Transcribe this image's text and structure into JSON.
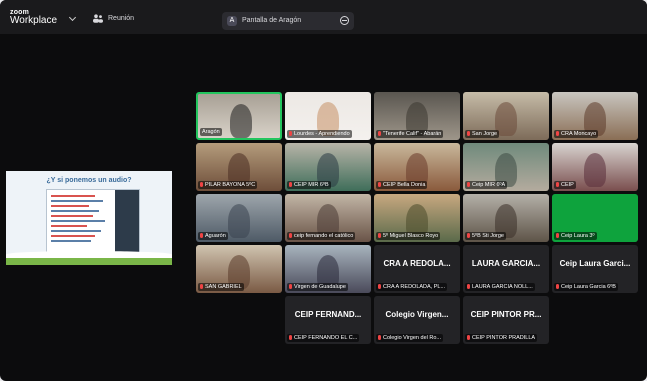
{
  "app": {
    "logo_top": "zoom",
    "logo_bottom": "Workplace",
    "meeting_label": "Reunión"
  },
  "share": {
    "avatar_letter": "A",
    "label": "Pantalla de Aragón"
  },
  "shared_screen": {
    "title": "¿Y si ponemos un audio?"
  },
  "tiles": [
    {
      "name": "Aragón",
      "type": "video",
      "speaking": true,
      "mic_muted": false,
      "bg": [
        "#a8a095",
        "#d8d2c8"
      ],
      "person": "#1d1d1d"
    },
    {
      "name": "Lourdes - Aprendiendo",
      "type": "video",
      "speaking": false,
      "mic_muted": true,
      "bg": [
        "#ece8e4",
        "#f4f1ee"
      ],
      "person": "#c79064"
    },
    {
      "name": "\"Tenerife Calif\" - Abarán",
      "type": "video",
      "speaking": false,
      "mic_muted": true,
      "bg": [
        "#5a5650",
        "#9e968a"
      ],
      "person": "#3a3630"
    },
    {
      "name": "San Jorge",
      "type": "video",
      "speaking": false,
      "mic_muted": true,
      "bg": [
        "#c6bca8",
        "#7d6b59"
      ],
      "person": "#6b4a3a"
    },
    {
      "name": "CRA Moncayo",
      "type": "video",
      "speaking": false,
      "mic_muted": true,
      "bg": [
        "#c9c6c0",
        "#8a6e55"
      ],
      "person": "#5c3b2a"
    },
    {
      "name": "PILAR BAYONA 5ºC",
      "type": "video",
      "speaking": false,
      "mic_muted": true,
      "bg": [
        "#b49c7c",
        "#6e4e3a"
      ],
      "person": "#4a2e22"
    },
    {
      "name": "CEIP MIR 6ºB",
      "type": "video",
      "speaking": false,
      "mic_muted": true,
      "bg": [
        "#b8b4a8",
        "#3f6e5a"
      ],
      "person": "#2a3a44"
    },
    {
      "name": "CEIP Bella Donia",
      "type": "video",
      "speaking": false,
      "mic_muted": true,
      "bg": [
        "#c9b89c",
        "#8a5a3c"
      ],
      "person": "#6a3a2a"
    },
    {
      "name": "Ceip MIR 6ºA",
      "type": "video",
      "speaking": false,
      "mic_muted": true,
      "bg": [
        "#6f8a7c",
        "#b4ab9e"
      ],
      "person": "#3c4a44"
    },
    {
      "name": "CEIP",
      "type": "video",
      "speaking": false,
      "mic_muted": true,
      "bg": [
        "#d8d4d0",
        "#7a4e4e"
      ],
      "person": "#5a2e3a"
    },
    {
      "name": "Aguarón",
      "type": "video",
      "speaking": false,
      "mic_muted": true,
      "bg": [
        "#9ea6ac",
        "#4e5a66"
      ],
      "person": "#3a4450"
    },
    {
      "name": "ceip fernando el católico",
      "type": "video",
      "speaking": false,
      "mic_muted": true,
      "bg": [
        "#c2b6a6",
        "#6a5448"
      ],
      "person": "#4a3a34"
    },
    {
      "name": "5º Miguel Blasco Royo",
      "type": "video",
      "speaking": false,
      "mic_muted": true,
      "bg": [
        "#c8a880",
        "#5a6a4a"
      ],
      "person": "#4a4a2a"
    },
    {
      "name": "5ºB Sti Jorge",
      "type": "video",
      "speaking": false,
      "mic_muted": true,
      "bg": [
        "#b4b0a8",
        "#5e5448"
      ],
      "person": "#3a3028"
    },
    {
      "name": "Ceip Laura 3º",
      "type": "green",
      "speaking": false,
      "mic_muted": true
    },
    {
      "name": "SAN GABRIEL",
      "type": "video",
      "speaking": false,
      "mic_muted": true,
      "bg": [
        "#d0c4b0",
        "#7a5a44"
      ],
      "person": "#5a3a2a"
    },
    {
      "name": "Virgen de Guadalupe",
      "type": "video",
      "speaking": false,
      "mic_muted": true,
      "bg": [
        "#a8b4be",
        "#4a4a5a"
      ],
      "person": "#2a2a3a"
    },
    {
      "name": "CRA A REDOLADA, PL...",
      "type": "text",
      "big": "CRA A REDOLA...",
      "speaking": false,
      "mic_muted": true
    },
    {
      "name": "LAURA GARCIA NOLL...",
      "type": "text",
      "big": "LAURA GARCIA...",
      "speaking": false,
      "mic_muted": true
    },
    {
      "name": "Ceip Laura Garcia 6ºB",
      "type": "text",
      "big": "Ceip Laura Garci...",
      "speaking": false,
      "mic_muted": true
    },
    {
      "name": "CEIP FERNANDO EL C...",
      "type": "text",
      "big": "CEIP FERNAND...",
      "speaking": false,
      "mic_muted": true
    },
    {
      "name": "Colegio Virgen del Ro...",
      "type": "text",
      "big": "Colegio Virgen...",
      "speaking": false,
      "mic_muted": true
    },
    {
      "name": "CEIP PINTOR PRADILLA",
      "type": "text",
      "big": "CEIP PINTOR PR...",
      "speaking": false,
      "mic_muted": true
    }
  ]
}
